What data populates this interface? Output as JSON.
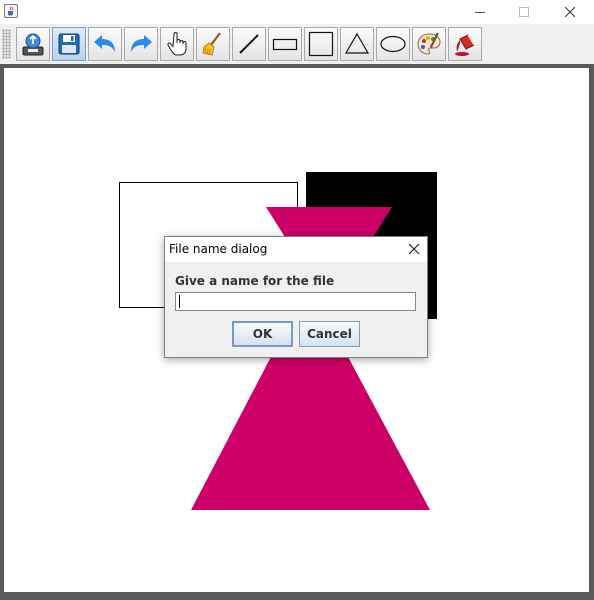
{
  "window": {
    "icons": {
      "app": "java-cup-icon",
      "minimize": "minimize-icon",
      "maximize": "maximize-icon",
      "close": "close-icon"
    }
  },
  "toolbar": {
    "tools": [
      {
        "name": "open-file",
        "icon": "open-file-icon",
        "active": false
      },
      {
        "name": "save-file",
        "icon": "floppy-disk-icon",
        "active": true
      },
      {
        "name": "undo",
        "icon": "undo-arrow-icon",
        "active": false
      },
      {
        "name": "redo",
        "icon": "redo-arrow-icon",
        "active": false
      },
      {
        "name": "select-move",
        "icon": "hand-pointer-icon",
        "active": false
      },
      {
        "name": "clear",
        "icon": "broom-icon",
        "active": false
      },
      {
        "name": "line",
        "icon": "line-icon",
        "active": false
      },
      {
        "name": "rectangle",
        "icon": "rectangle-icon",
        "active": false
      },
      {
        "name": "square",
        "icon": "square-icon",
        "active": false
      },
      {
        "name": "triangle",
        "icon": "triangle-icon",
        "active": false
      },
      {
        "name": "ellipse",
        "icon": "ellipse-icon",
        "active": false
      },
      {
        "name": "color-palette",
        "icon": "palette-icon",
        "active": false
      },
      {
        "name": "fill-color",
        "icon": "paint-bucket-icon",
        "active": false
      }
    ]
  },
  "canvas": {
    "shapes": [
      {
        "type": "rectangle",
        "fill": "#ffffff",
        "stroke": "#000000"
      },
      {
        "type": "square",
        "fill": "#000000"
      },
      {
        "type": "triangle",
        "fill": "#cc0066"
      },
      {
        "type": "triangle",
        "fill": "#cc0066"
      }
    ]
  },
  "dialog": {
    "title": "File name dialog",
    "prompt": "Give a name for the file",
    "input_value": "",
    "ok_label": "OK",
    "cancel_label": "Cancel"
  },
  "colors": {
    "accent": "#cc0066",
    "button_blue": "#7a99c0"
  }
}
